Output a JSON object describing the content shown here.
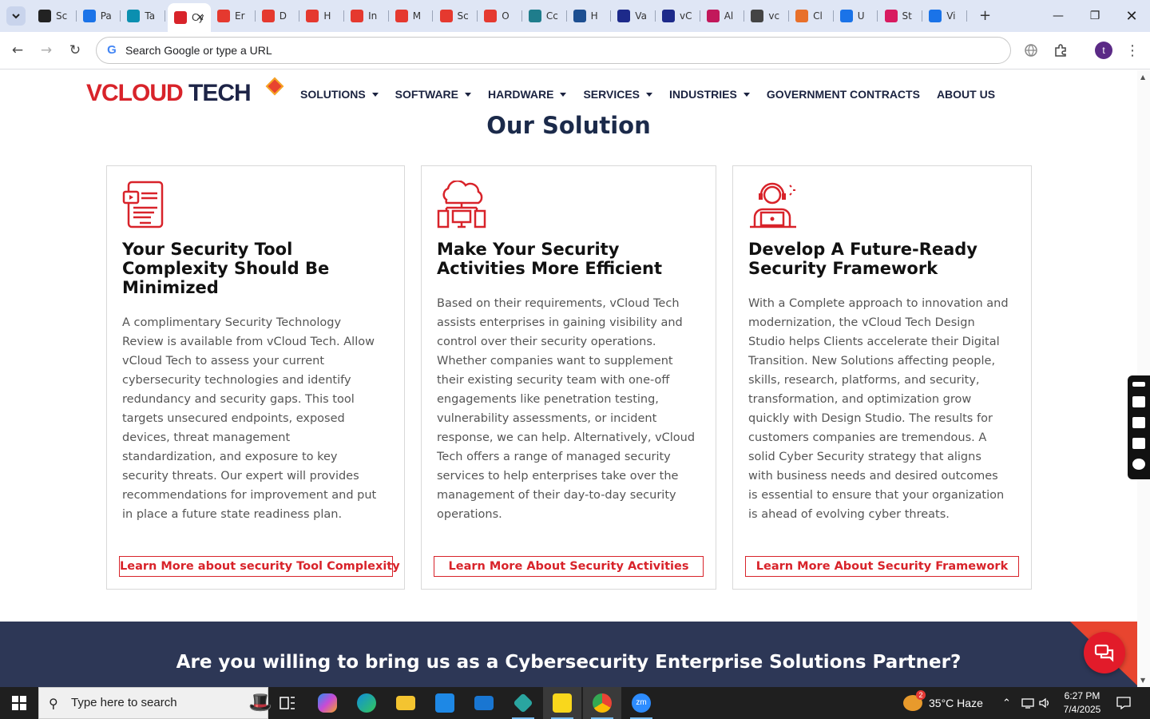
{
  "browser": {
    "tabs": [
      {
        "label": "Sc",
        "color": "#222222"
      },
      {
        "label": "Pa",
        "color": "#1a73e8"
      },
      {
        "label": "Ta",
        "color": "#0b8fb0"
      },
      {
        "label": "Cy",
        "color": "#d8232a",
        "active": true
      },
      {
        "label": "Er",
        "color": "#e5392f"
      },
      {
        "label": "D",
        "color": "#e5392f"
      },
      {
        "label": "H",
        "color": "#e5392f"
      },
      {
        "label": "In",
        "color": "#e5392f"
      },
      {
        "label": "M",
        "color": "#e5392f"
      },
      {
        "label": "Sc",
        "color": "#e5392f"
      },
      {
        "label": "O",
        "color": "#e5392f"
      },
      {
        "label": "Cc",
        "color": "#1f7d8c"
      },
      {
        "label": "H",
        "color": "#1d4f91"
      },
      {
        "label": "Va",
        "color": "#1d2a8a"
      },
      {
        "label": "vC",
        "color": "#1d2a8a"
      },
      {
        "label": "Al",
        "color": "#c2185b"
      },
      {
        "label": "vc",
        "color": "#444444"
      },
      {
        "label": "Cl",
        "color": "#e8702a"
      },
      {
        "label": "U",
        "color": "#1a73e8"
      },
      {
        "label": "St",
        "color": "#d81b60"
      },
      {
        "label": "Vi",
        "color": "#1a73e8"
      }
    ],
    "omnibox_placeholder": "Search Google or type a URL",
    "profile_initial": "t"
  },
  "site": {
    "logo": {
      "v": "V",
      "cloud": "CLOUD",
      "tech": "TECH"
    },
    "nav": [
      {
        "label": "SOLUTIONS",
        "dropdown": true
      },
      {
        "label": "SOFTWARE",
        "dropdown": true
      },
      {
        "label": "HARDWARE",
        "dropdown": true
      },
      {
        "label": "SERVICES",
        "dropdown": true
      },
      {
        "label": "INDUSTRIES",
        "dropdown": true
      },
      {
        "label": "GOVERNMENT CONTRACTS",
        "dropdown": false
      },
      {
        "label": "ABOUT US",
        "dropdown": false
      }
    ],
    "section_title": "Our Solution",
    "cards": [
      {
        "icon": "tablet-document-icon",
        "title_lines": [
          "Your Security Tool",
          "Complexity Should Be",
          "Minimized"
        ],
        "body_lines": [
          "A complimentary Security Technology",
          "Review is available from vCloud Tech. Allow",
          "vCloud Tech to assess your current",
          "cybersecurity technologies and identify",
          "redundancy and security gaps. This tool",
          "targets unsecured endpoints, exposed",
          "devices, threat management",
          "standardization, and exposure to key",
          "security threats. Our expert will provides",
          "recommendations for improvement and put",
          "in place a future state readiness plan."
        ],
        "button": "Learn More about security Tool Complexity"
      },
      {
        "icon": "cloud-devices-icon",
        "title_lines": [
          "Make Your Security",
          "Activities More Efficient"
        ],
        "body_lines": [
          "Based on their requirements, vCloud Tech",
          "assists enterprises in gaining visibility and",
          "control over their security operations.",
          "Whether companies want to supplement",
          "their existing security team with one-off",
          "engagements like penetration testing,",
          "vulnerability assessments, or incident",
          "response, we can help. Alternatively, vCloud",
          "Tech offers a range of managed security",
          "services to help enterprises take over the",
          "management of their day-to-day security",
          "operations."
        ],
        "button": "Learn More About Security Activities"
      },
      {
        "icon": "support-agent-icon",
        "title_lines": [
          "Develop A Future-Ready",
          "Security Framework"
        ],
        "body_lines": [
          "With a Complete approach to innovation and",
          "modernization, the vCloud Tech Design",
          "Studio helps Clients accelerate their Digital",
          "Transition. New Solutions affecting people,",
          "skills, research, platforms, and security,",
          "transformation, and optimization grow",
          "quickly with Design Studio. The results for",
          "customers companies are tremendous. A",
          "solid Cyber Security strategy that aligns",
          "with business needs and desired outcomes",
          "is essential to ensure that your organization",
          "is ahead of evolving cyber threats."
        ],
        "button": "Learn More About Security Framework"
      }
    ],
    "banner_text": "Are you willing to bring us as a Cybersecurity Enterprise Solutions Partner?",
    "accent_color": "#d8232a",
    "navy_color": "#1b2a4a"
  },
  "taskbar": {
    "search_placeholder": "Type here to search",
    "weather_badge": "2",
    "weather": "35°C  Haze",
    "time": "6:27 PM",
    "date": "7/4/2025"
  }
}
